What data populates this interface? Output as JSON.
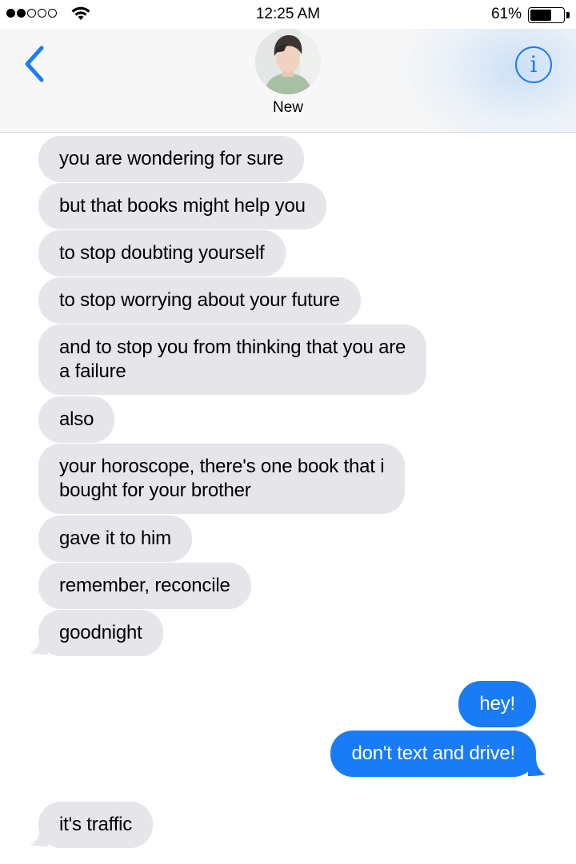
{
  "status_bar": {
    "signal_bars_filled": 2,
    "signal_bars_total": 5,
    "time": "12:25 AM",
    "battery_percent": "61%",
    "battery_level": 0.61
  },
  "header": {
    "contact_name": "New",
    "back_icon": "chevron-left-icon",
    "info_icon": "info-circle-icon",
    "accent_color": "#1a7cf5"
  },
  "colors": {
    "incoming_bubble": "#e5e5ea",
    "outgoing_bubble": "#1a7cf5"
  },
  "messages": [
    {
      "direction": "incoming",
      "text": "you are wondering for sure"
    },
    {
      "direction": "incoming",
      "text": "but that books might help you"
    },
    {
      "direction": "incoming",
      "text": "to stop doubting yourself"
    },
    {
      "direction": "incoming",
      "text": "to stop worrying about your future"
    },
    {
      "direction": "incoming",
      "lines": [
        "and to stop you from thinking that you are",
        "a failure"
      ]
    },
    {
      "direction": "incoming",
      "text": "also"
    },
    {
      "direction": "incoming",
      "lines": [
        "your horoscope, there's one book that i",
        "bought for your brother"
      ]
    },
    {
      "direction": "incoming",
      "text": "gave it to him"
    },
    {
      "direction": "incoming",
      "text": "remember, reconcile"
    },
    {
      "direction": "incoming",
      "text": "goodnight"
    },
    {
      "direction": "outgoing",
      "text": "hey!"
    },
    {
      "direction": "outgoing",
      "text": "don't text and drive!"
    },
    {
      "direction": "incoming",
      "text": "it's traffic"
    }
  ]
}
